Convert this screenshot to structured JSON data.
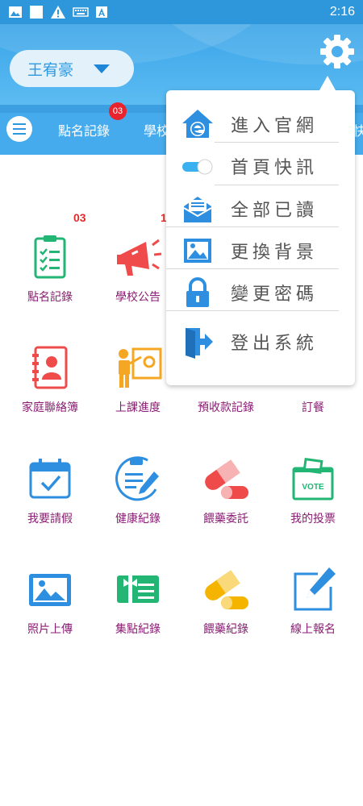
{
  "status_bar": {
    "time": "2:16",
    "icons": [
      "image-icon",
      "square-icon",
      "warning-icon",
      "keyboard-icon",
      "a-icon"
    ]
  },
  "header": {
    "user_name": "王宥豪",
    "settings_icon": "gear-icon"
  },
  "tabs": {
    "items": [
      {
        "label": "點名記錄",
        "badge": "03"
      },
      {
        "label": "學校"
      },
      {
        "label": "快"
      }
    ]
  },
  "grid": {
    "items": [
      {
        "label": "點名記錄",
        "icon": "clipboard-check-icon",
        "count": "03"
      },
      {
        "label": "學校公告",
        "icon": "megaphone-icon",
        "count": "1"
      },
      {
        "label": "家庭聯絡簿",
        "icon": "contact-book-icon"
      },
      {
        "label": "上課進度",
        "icon": "teacher-board-icon"
      },
      {
        "label": "預收款記錄",
        "icon": "payment-icon"
      },
      {
        "label": "訂餐",
        "icon": "meal-icon"
      },
      {
        "label": "我要請假",
        "icon": "calendar-check-icon"
      },
      {
        "label": "健康紀錄",
        "icon": "health-record-icon"
      },
      {
        "label": "餵藥委託",
        "icon": "pill-red-icon"
      },
      {
        "label": "我的投票",
        "icon": "ballot-box-icon"
      },
      {
        "label": "照片上傳",
        "icon": "photo-icon"
      },
      {
        "label": "集點紀錄",
        "icon": "gift-card-icon"
      },
      {
        "label": "餵藥紀錄",
        "icon": "pill-yellow-icon"
      },
      {
        "label": "線上報名",
        "icon": "edit-form-icon"
      }
    ],
    "vote_text": "VOTE"
  },
  "dropdown": {
    "items": [
      {
        "label": "進入官網",
        "icon": "ie-home-icon"
      },
      {
        "label": "首頁快訊",
        "icon": "toggle-icon",
        "toggle_on": true
      },
      {
        "label": "全部已讀",
        "icon": "mail-icon"
      },
      {
        "label": "更換背景",
        "icon": "image-icon"
      },
      {
        "label": "變更密碼",
        "icon": "lock-icon"
      },
      {
        "label": "登出系統",
        "icon": "logout-icon"
      }
    ]
  },
  "colors": {
    "header_blue": "#3aa4e6",
    "label_purple": "#8a1d73",
    "badge_red": "#e8232d",
    "icon_blue": "#2e8fe0",
    "icon_green": "#22b573",
    "icon_red": "#ef4b4b",
    "icon_orange": "#f5a623"
  }
}
